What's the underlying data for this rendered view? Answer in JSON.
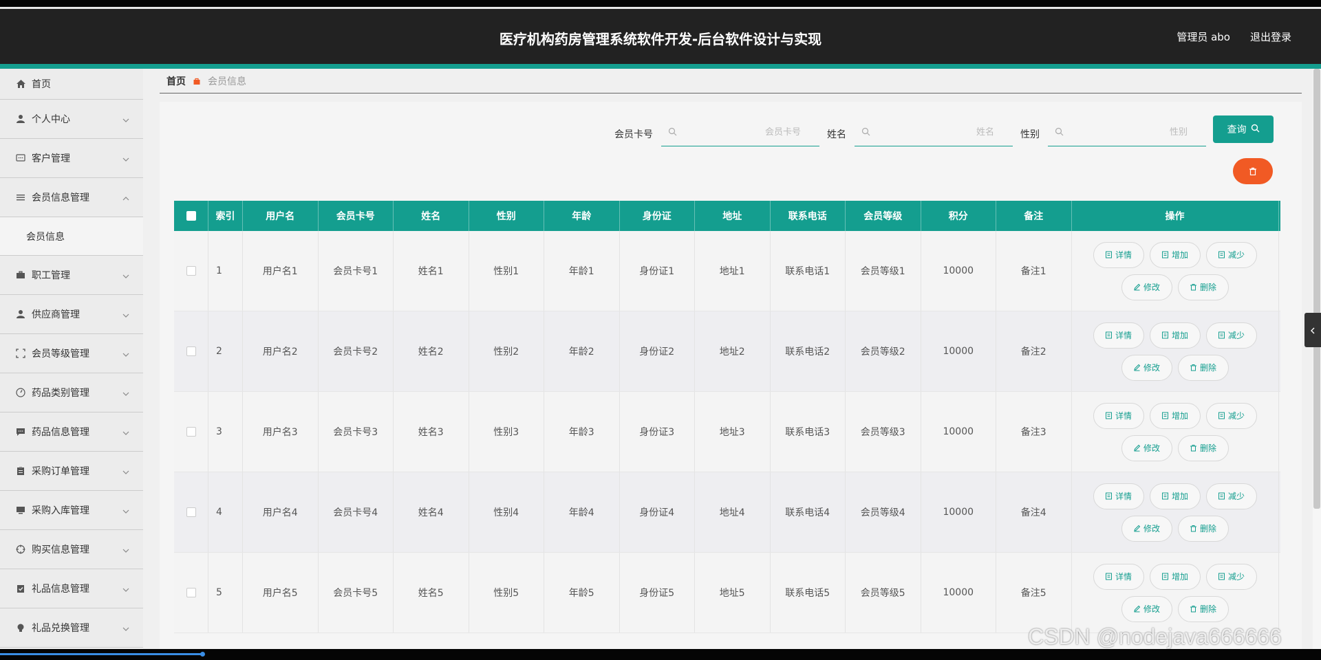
{
  "header": {
    "title": "医疗机构药房管理系统软件开发-后台软件设计与实现",
    "user": "管理员 abo",
    "logout": "退出登录"
  },
  "sidebar": {
    "items": [
      {
        "label": "首页",
        "icon": "home-icon"
      },
      {
        "label": "个人中心",
        "icon": "user-icon"
      },
      {
        "label": "客户管理",
        "icon": "chat-icon"
      },
      {
        "label": "会员信息管理",
        "icon": "list-icon",
        "expanded": true,
        "children": [
          {
            "label": "会员信息"
          }
        ]
      },
      {
        "label": "职工管理",
        "icon": "briefcase-icon"
      },
      {
        "label": "供应商管理",
        "icon": "user-icon"
      },
      {
        "label": "会员等级管理",
        "icon": "fullscreen-icon"
      },
      {
        "label": "药品类别管理",
        "icon": "compass-icon"
      },
      {
        "label": "药品信息管理",
        "icon": "message-icon"
      },
      {
        "label": "采购订单管理",
        "icon": "clipboard-icon"
      },
      {
        "label": "采购入库管理",
        "icon": "monitor-icon"
      },
      {
        "label": "购买信息管理",
        "icon": "crosshair-icon"
      },
      {
        "label": "礼品信息管理",
        "icon": "check-clipboard-icon"
      },
      {
        "label": "礼品兑换管理",
        "icon": "bulb-icon"
      }
    ]
  },
  "breadcrumb": {
    "home": "首页",
    "current": "会员信息"
  },
  "search": {
    "card_label": "会员卡号",
    "card_placeholder": "会员卡号",
    "name_label": "姓名",
    "name_placeholder": "姓名",
    "gender_label": "性别",
    "gender_placeholder": "性别",
    "query": "查询"
  },
  "table": {
    "headers": [
      "索引",
      "用户名",
      "会员卡号",
      "姓名",
      "性别",
      "年龄",
      "身份证",
      "地址",
      "联系电话",
      "会员等级",
      "积分",
      "备注",
      "操作"
    ],
    "rows": [
      [
        "1",
        "用户名1",
        "会员卡号1",
        "姓名1",
        "性别1",
        "年龄1",
        "身份证1",
        "地址1",
        "联系电话1",
        "会员等级1",
        "10000",
        "备注1"
      ],
      [
        "2",
        "用户名2",
        "会员卡号2",
        "姓名2",
        "性别2",
        "年龄2",
        "身份证2",
        "地址2",
        "联系电话2",
        "会员等级2",
        "10000",
        "备注2"
      ],
      [
        "3",
        "用户名3",
        "会员卡号3",
        "姓名3",
        "性别3",
        "年龄3",
        "身份证3",
        "地址3",
        "联系电话3",
        "会员等级3",
        "10000",
        "备注3"
      ],
      [
        "4",
        "用户名4",
        "会员卡号4",
        "姓名4",
        "性别4",
        "年龄4",
        "身份证4",
        "地址4",
        "联系电话4",
        "会员等级4",
        "10000",
        "备注4"
      ],
      [
        "5",
        "用户名5",
        "会员卡号5",
        "姓名5",
        "性别5",
        "年龄5",
        "身份证5",
        "地址5",
        "联系电话5",
        "会员等级5",
        "10000",
        "备注5"
      ]
    ],
    "actions": [
      "详情",
      "增加",
      "减少",
      "修改",
      "删除"
    ]
  },
  "watermark": "CSDN @nodejava666666",
  "colors": {
    "accent": "#149e8f",
    "danger": "#f15a24",
    "header": "#222222"
  }
}
